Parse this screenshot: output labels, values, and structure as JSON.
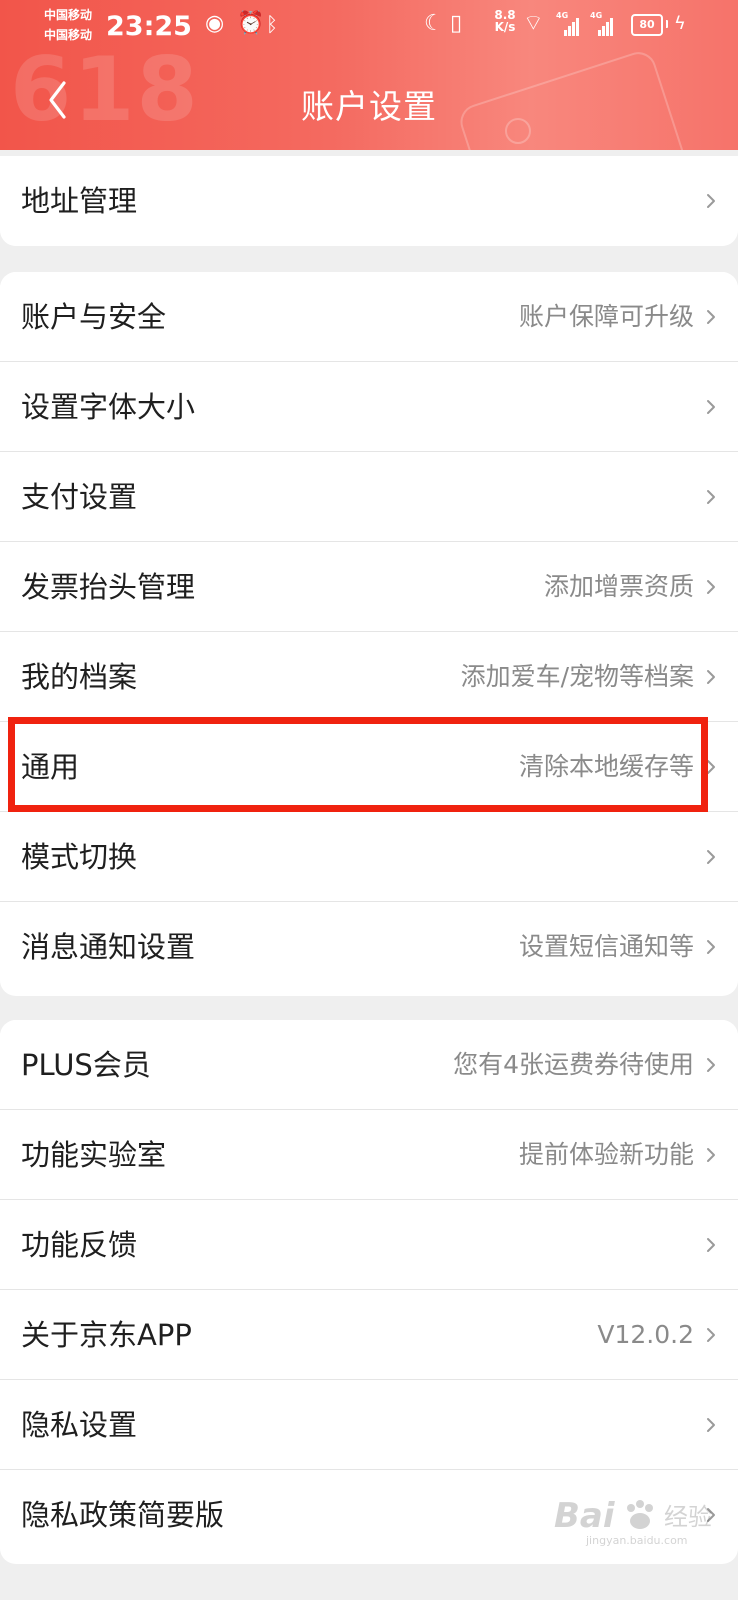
{
  "status_bar": {
    "carrier_1": "中国移动",
    "carrier_2": "中国移动",
    "time": "23:25",
    "network_speed": "8.8 K/s",
    "signal_1_type": "4G",
    "signal_2_type": "4G",
    "battery_percent": "80",
    "icons": [
      "eye-icon",
      "alarm-icon",
      "bluetooth-icon",
      "moon-icon",
      "vibrate-icon",
      "wifi-icon",
      "charge-icon"
    ]
  },
  "header": {
    "title": "账户设置",
    "back_icon": "chevron-left-icon",
    "decoration_text": "618"
  },
  "groups": [
    {
      "items": [
        {
          "label": "地址管理",
          "sub": ""
        }
      ]
    },
    {
      "items": [
        {
          "label": "账户与安全",
          "sub": "账户保障可升级"
        },
        {
          "label": "设置字体大小",
          "sub": ""
        },
        {
          "label": "支付设置",
          "sub": ""
        },
        {
          "label": "发票抬头管理",
          "sub": "添加增票资质"
        },
        {
          "label": "我的档案",
          "sub": "添加爱车/宠物等档案"
        },
        {
          "label": "通用",
          "sub": "清除本地缓存等"
        },
        {
          "label": "模式切换",
          "sub": ""
        },
        {
          "label": "消息通知设置",
          "sub": "设置短信通知等"
        }
      ]
    },
    {
      "items": [
        {
          "label": "PLUS会员",
          "sub": "您有4张运费券待使用"
        },
        {
          "label": "功能实验室",
          "sub": "提前体验新功能"
        },
        {
          "label": "功能反馈",
          "sub": ""
        },
        {
          "label": "关于京东APP",
          "sub": "V12.0.2"
        },
        {
          "label": "隐私设置",
          "sub": ""
        },
        {
          "label": "隐私政策简要版",
          "sub": ""
        }
      ]
    }
  ],
  "highlight": {
    "target": "通用",
    "color": "#f0220f"
  },
  "watermark": {
    "logo": "Bai",
    "text": "经验",
    "url": "jingyan.baidu.com"
  },
  "colors": {
    "header_start": "#f2554a",
    "header_end": "#f6736a",
    "background": "#efefef",
    "card": "#ffffff",
    "primary_text": "#1f1f1f",
    "secondary_text": "#8a8a8a",
    "divider": "#e5e5e5",
    "highlight": "#f0220f"
  }
}
